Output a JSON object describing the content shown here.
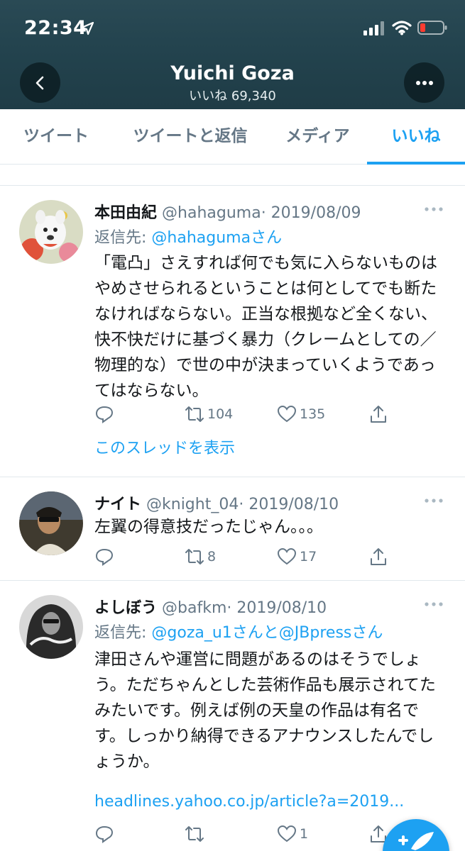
{
  "status_bar": {
    "time": "22:34"
  },
  "header": {
    "name": "Yuichi Goza",
    "subtitle": "いいね 69,340"
  },
  "tabs": [
    {
      "label": "ツイート"
    },
    {
      "label": "ツイートと返信"
    },
    {
      "label": "メディア"
    },
    {
      "label": "いいね",
      "active": true
    }
  ],
  "tweets": [
    {
      "name": "本田由紀",
      "handle": "@hahaguma",
      "date": "· 2019/08/09",
      "reply_prefix": "返信先: ",
      "reply_to": "@hahagumaさん",
      "text": "「電凸」さえすれば何でも気に入らないものはやめさせられるということは何としてでも断たなければならない。正当な根拠など全くない、快不快だけに基づく暴力（クレームとしての／物理的な）で世の中が決まっていくようであってはならない。",
      "retweets": "104",
      "likes": "135",
      "thread_link": "このスレッドを表示"
    },
    {
      "name": "ナイト",
      "handle": "@knight_04",
      "date": "· 2019/08/10",
      "text": "左翼の得意技だったじゃん。。。",
      "retweets": "8",
      "likes": "17"
    },
    {
      "name": "よしぼう",
      "handle": "@bafkm",
      "date": "· 2019/08/10",
      "reply_prefix": "返信先: ",
      "reply_to": "@goza_u1さんと@JBpressさん",
      "text": "津田さんや運営に問題があるのはそうでしょう。ただちゃんとした芸術作品も展示されてたみたいです。例えば例の天皇の作品は有名です。しっかり納得できるアナウンスしたんでしょうか。",
      "link": "headlines.yahoo.co.jp/article?a=2019...",
      "retweets": "",
      "likes": "1"
    }
  ],
  "colors": {
    "accent": "#1da1f2",
    "muted": "#657786",
    "header_bg": "#23434e"
  },
  "icons": [
    "location-arrow-icon",
    "signal-icon",
    "wifi-icon",
    "battery-icon",
    "back-arrow-icon",
    "more-dots-icon",
    "reply-icon",
    "retweet-icon",
    "like-icon",
    "share-icon",
    "compose-icon"
  ]
}
